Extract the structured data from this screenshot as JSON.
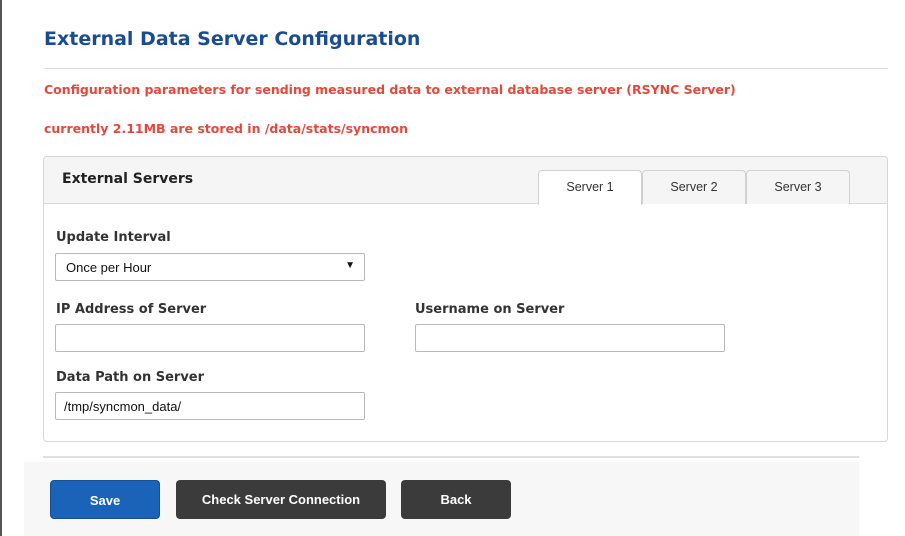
{
  "page": {
    "title": "External Data Server Configuration",
    "info_line_1": "Configuration parameters for sending measured data to external database server (RSYNC Server)",
    "info_line_2": "currently 2.11MB are stored in /data/stats/syncmon"
  },
  "panel": {
    "title": "External Servers",
    "tabs": [
      {
        "label": "Server 1",
        "active": true
      },
      {
        "label": "Server 2",
        "active": false
      },
      {
        "label": "Server 3",
        "active": false
      }
    ]
  },
  "form": {
    "update_interval": {
      "label": "Update Interval",
      "value": "Once per Hour"
    },
    "ip_address": {
      "label": "IP Address of Server",
      "value": ""
    },
    "username": {
      "label": "Username on Server",
      "value": ""
    },
    "data_path": {
      "label": "Data Path on Server",
      "value": "/tmp/syncmon_data/"
    }
  },
  "buttons": {
    "save": "Save",
    "check": "Check Server Connection",
    "back": "Back"
  },
  "colors": {
    "title": "#1a4d8f",
    "info_text": "#e04a3d",
    "primary_button": "#1a63b8",
    "dark_button": "#3b3b3b"
  },
  "icons": {
    "dropdown": "chevron-down-icon"
  }
}
